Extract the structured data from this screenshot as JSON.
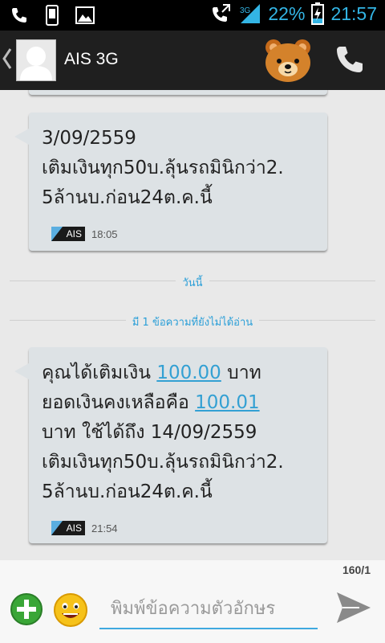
{
  "status_bar": {
    "battery_percent": "22%",
    "time": "21:57",
    "icons": [
      "phone-icon",
      "device-icon",
      "image-icon",
      "call-forward-icon",
      "signal-icon",
      "battery-charging-icon"
    ],
    "accent": "#33b5e5"
  },
  "header": {
    "title": "AIS 3G",
    "icons": [
      "back-chevron-icon",
      "contact-avatar-icon",
      "bear-sticker-icon",
      "call-icon"
    ]
  },
  "messages": [
    {
      "lines": [
        "3/09/2559",
        "เติมเงินทุก50บ.ลุ้นรถมินิกว่า2.",
        "5ล้านบ.ก่อน24ต.ค.นี้"
      ],
      "badge": "AIS",
      "time": "18:05"
    },
    {
      "line1_prefix": "คุณได้เติมเงิน ",
      "line1_amount": "100.00",
      "line1_suffix": " บาท",
      "line2_prefix": "ยอดเงินคงเหลือคือ ",
      "line2_amount": "100.01",
      "line3": "บาท ใช้ได้ถึง 14/09/2559",
      "line4": "เติมเงินทุก50บ.ลุ้นรถมินิกว่า2.",
      "line5": "5ล้านบ.ก่อน24ต.ค.นี้",
      "badge": "AIS",
      "time": "21:54"
    }
  ],
  "dividers": {
    "today": "วันนี้",
    "unread": "มี 1 ข้อความที่ยังไม่ได้อ่าน"
  },
  "compose": {
    "char_count": "160/1",
    "placeholder": "พิมพ์ข้อความตัวอักษร",
    "icons": [
      "add-attachment-icon",
      "emoji-icon",
      "send-icon"
    ],
    "accent": "#3fa9df"
  },
  "colors": {
    "bubble": "#dde2e5",
    "background": "#e9e9e9",
    "link": "#33a0d3",
    "header": "#1f1f1f"
  }
}
